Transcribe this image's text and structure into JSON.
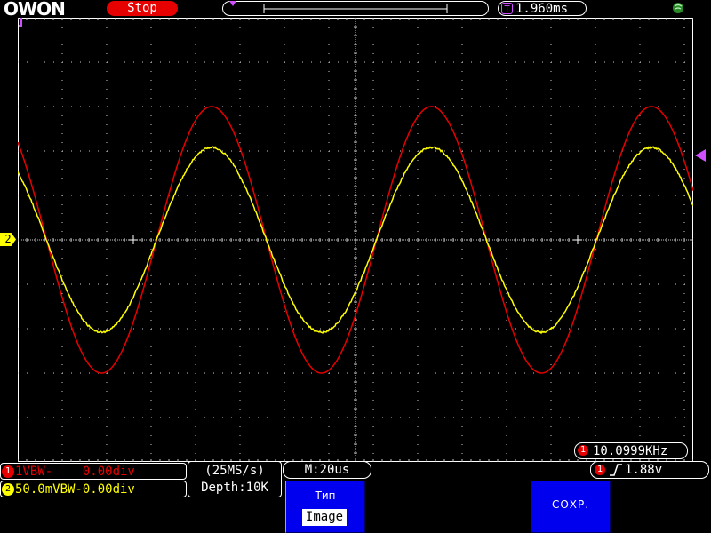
{
  "header": {
    "logo": "OWON",
    "run_status": "Stop",
    "trigger_time": "1.960ms",
    "trigger_time_icon": "T"
  },
  "markers": {
    "ch2": "2"
  },
  "measurement": {
    "channel": "1",
    "frequency": "10.0999KHz"
  },
  "channels": [
    {
      "num": "1",
      "text": "1VBW-    0.00div",
      "color": "#e60000"
    },
    {
      "num": "2",
      "text": "50.0mVBW-0.00div",
      "color": "#ffff00"
    }
  ],
  "acquisition": {
    "sample_rate": "(25MS/s)",
    "depth": "Depth:10K"
  },
  "timebase": "M:20us",
  "trigger": {
    "channel": "1",
    "level": "1.88v",
    "slope_icon": "rising-edge-icon"
  },
  "menu": {
    "type_label": "Тип",
    "type_value": "Image",
    "save_label": "СОХР."
  },
  "waveforms": {
    "period_us": 99.0,
    "ch1": {
      "color": "#e60000",
      "amplitude_div": 3.0
    },
    "ch2": {
      "color": "#ffff00",
      "amplitude_div": 2.08
    }
  }
}
